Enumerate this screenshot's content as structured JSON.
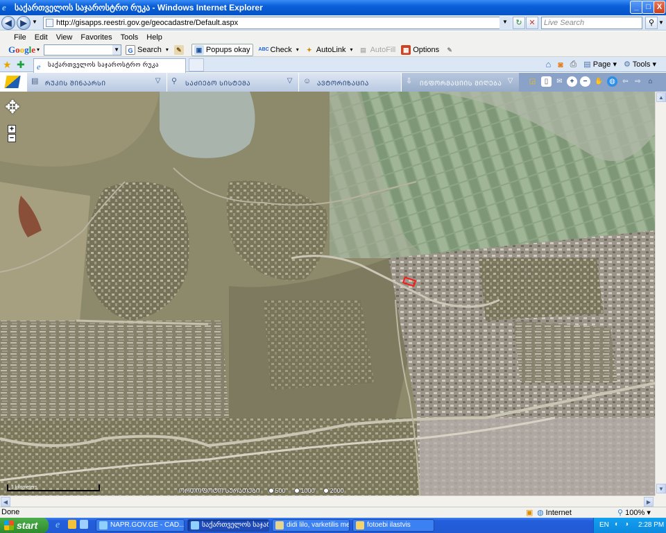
{
  "window": {
    "title": "საქართველოს საჯაროსტრო რუკა - Windows Internet Explorer",
    "minimize": "_",
    "maximize": "□",
    "close": "X"
  },
  "address": {
    "back": "◀",
    "forward": "▶",
    "url": "http://gisapps.reestri.gov.ge/geocadastre/Default.aspx",
    "refresh": "↻",
    "stop": "✕",
    "search_placeholder": "Live Search",
    "search_go": "⚲"
  },
  "menu": [
    "File",
    "Edit",
    "View",
    "Favorites",
    "Tools",
    "Help"
  ],
  "google_toolbar": {
    "logo": "Google",
    "search_label": "Search",
    "popups_label": "Popups okay",
    "check_label": "Check",
    "autolink_label": "AutoLink",
    "autofill_label": "AutoFill",
    "options_label": "Options"
  },
  "tabs": {
    "active_tab": "საქართველოს საჯაროსტრო რუკა",
    "page_menu": "Page",
    "tools_menu": "Tools"
  },
  "app_toolbar": {
    "dropdowns": [
      {
        "label": "ᲠᲣᲙᲘᲡ ᲨᲘᲜᲐᲐᲠᲡᲘ",
        "icon": "document-icon"
      },
      {
        "label": "ᲡᲐᲫᲘᲔᲑᲝ ᲡᲘᲡᲢᲔᲛᲐ",
        "icon": "search-icon"
      },
      {
        "label": "ᲐᲕᲢᲝᲠᲘᲖᲐᲪᲘᲐ",
        "icon": "user-icon"
      },
      {
        "label": "ᲘᲜᲤᲝᲠᲛᲐᲪᲘᲘᲡ ᲛᲘᲦᲔᲑᲐ",
        "icon": "download-icon"
      }
    ]
  },
  "map": {
    "zoom_in": "+",
    "zoom_out": "−",
    "pan": "✥",
    "scale_label": "1 kilometers",
    "scale_caption": "ᲝᲠᲗᲝᲤᲝᲢᲝ ᲡᲣᲠᲐᲗᲔᲑᲘ",
    "scale_options": [
      "500",
      "1000",
      "2000"
    ]
  },
  "status": {
    "text": "Done",
    "zone": "Internet",
    "zoom": "100%"
  },
  "taskbar": {
    "start": "start",
    "tasks": [
      {
        "label": "NAPR.GOV.GE - CAD..."
      },
      {
        "label": "საქართველოს საჯაროს..."
      },
      {
        "label": "didi lilo, varketilis meu..."
      },
      {
        "label": "fotoebi ilastvis"
      }
    ],
    "lang": "EN",
    "clock": "2:28 PM"
  }
}
